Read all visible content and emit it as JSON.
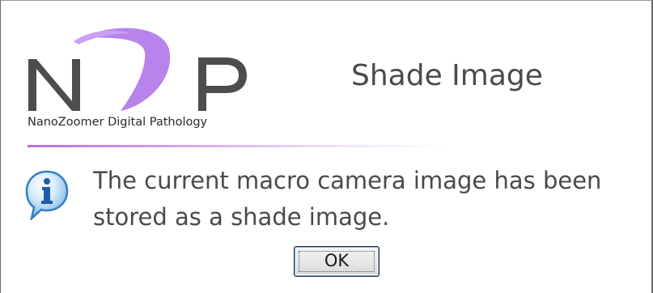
{
  "logo": {
    "letters": "NDP",
    "tagline": "NanoZoomer Digital Pathology"
  },
  "dialog": {
    "title": "Shade Image",
    "message_line1": "The current macro camera image has been",
    "message_line2": "stored as a shade image."
  },
  "buttons": {
    "ok_label": "OK"
  },
  "colors": {
    "brand_purple": "#b86ee0",
    "logo_gray": "#4d4d4d",
    "text_gray": "#4a4a4a",
    "info_blue": "#2f7fc8"
  },
  "icons": {
    "message_icon": "info-icon"
  }
}
